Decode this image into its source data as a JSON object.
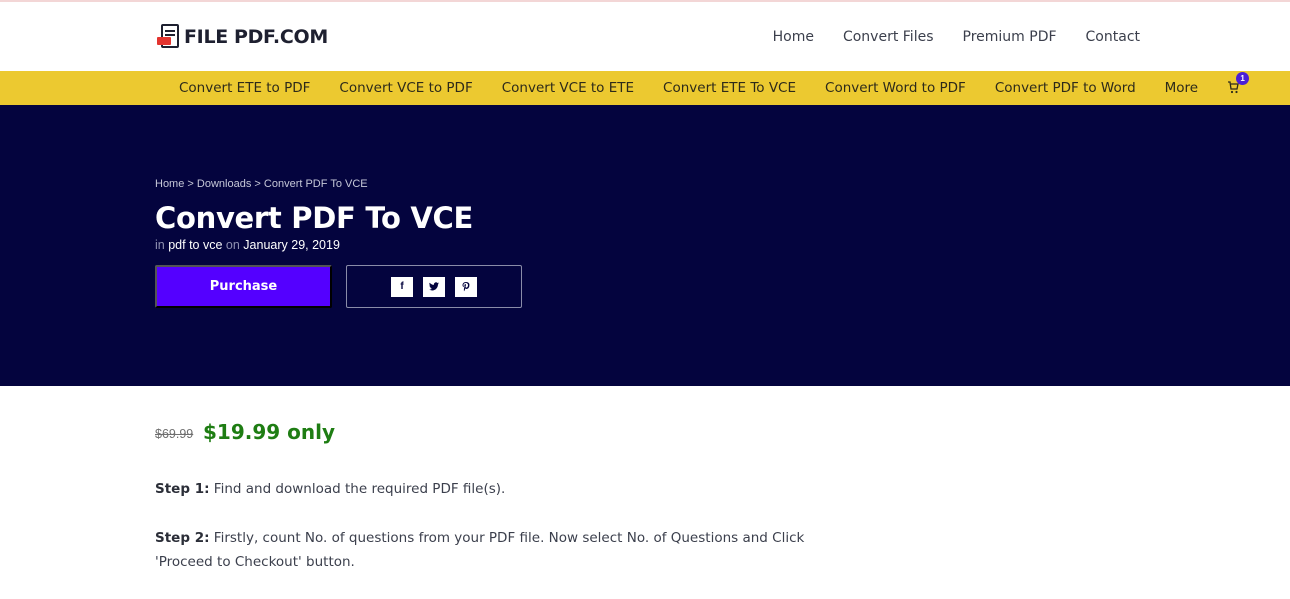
{
  "logo": {
    "part1": "FILE",
    "part2": "PDF.COM"
  },
  "main_nav": [
    "Home",
    "Convert Files",
    "Premium PDF",
    "Contact"
  ],
  "sub_nav": [
    "Convert ETE to PDF",
    "Convert VCE to PDF",
    "Convert VCE to ETE",
    "Convert ETE To VCE",
    "Convert Word to PDF",
    "Convert PDF to Word",
    "More"
  ],
  "cart": {
    "icon": "cart-icon",
    "count": "1"
  },
  "hero": {
    "breadcrumb": [
      "Home",
      "Downloads",
      "Convert PDF To VCE"
    ],
    "breadcrumb_sep": ">",
    "title": "Convert PDF To VCE",
    "meta": {
      "in": "in",
      "category": "pdf to vce",
      "on": "on",
      "date": "January 29, 2019"
    },
    "purchase_label": "Purchase",
    "share": [
      {
        "icon": "facebook-icon",
        "glyph": "f"
      },
      {
        "icon": "twitter-icon",
        "glyph": "🐦"
      },
      {
        "icon": "pinterest-icon",
        "glyph": "P"
      }
    ]
  },
  "pricing": {
    "old": "$69.99",
    "new": "$19.99 only"
  },
  "steps": [
    {
      "label": "Step 1:",
      "text": "Find and download the required PDF file(s)."
    },
    {
      "label": "Step 2:",
      "text": "Firstly, count No. of questions from your PDF file. Now select No. of Questions and Click 'Proceed to Checkout' button."
    }
  ],
  "colors": {
    "accent_bar": "#ecc930",
    "hero_bg": "#04043e",
    "purchase": "#5400ff",
    "price": "#1e7d13"
  }
}
